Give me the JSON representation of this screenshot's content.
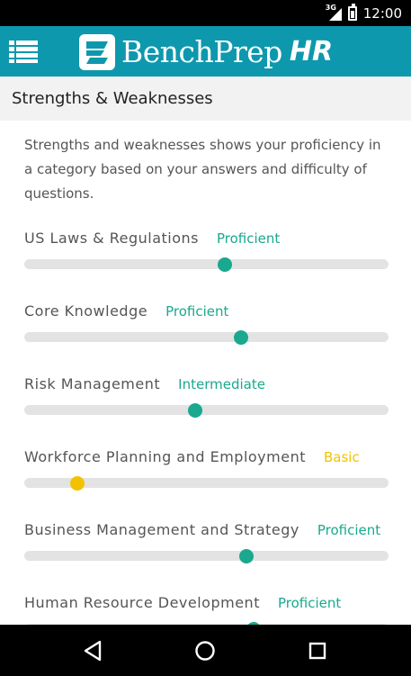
{
  "status_bar": {
    "network": "3G",
    "time": "12:00"
  },
  "app_bar": {
    "logo_text": "BenchPrep",
    "logo_suffix": "HR"
  },
  "page": {
    "title": "Strengths & Weaknesses",
    "intro": "Strengths and weaknesses shows your proficiency in a category based on your answers and difficulty of questions."
  },
  "colors": {
    "brand": "#0e98ad",
    "proficient": "#1aa88e",
    "basic": "#e8c21a",
    "track": "#e3e3e3"
  },
  "categories": [
    {
      "label": "US Laws & Regulations",
      "level": "Proficient",
      "color": "#1aa88e",
      "value": 0.55
    },
    {
      "label": "Core Knowledge",
      "level": "Proficient",
      "color": "#1aa88e",
      "value": 0.595
    },
    {
      "label": "Risk Management",
      "level": "Intermediate",
      "color": "#1aa88e",
      "value": 0.47
    },
    {
      "label": "Workforce Planning and Employment",
      "level": "Basic",
      "color": "#f2c200",
      "value": 0.145
    },
    {
      "label": "Business Management and Strategy",
      "level": "Proficient",
      "color": "#1aa88e",
      "value": 0.61
    },
    {
      "label": "Human Resource Development",
      "level": "Proficient",
      "color": "#1aa88e",
      "value": 0.63
    }
  ]
}
